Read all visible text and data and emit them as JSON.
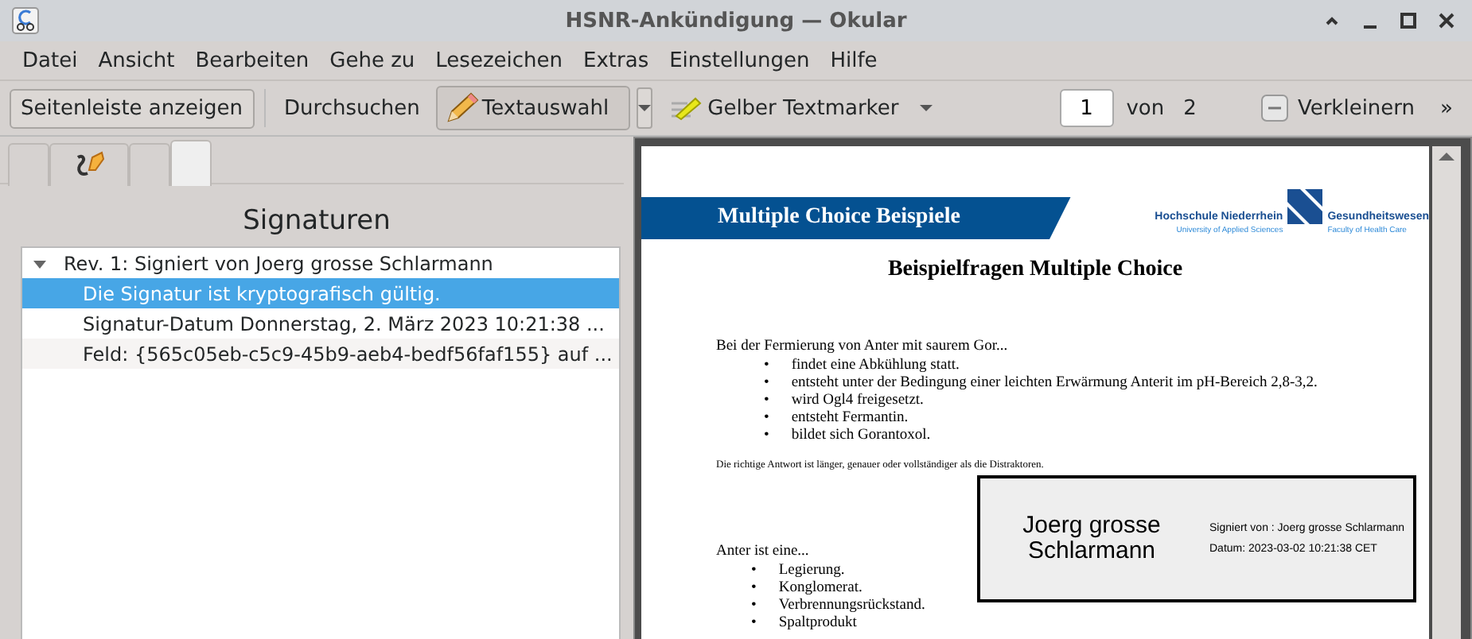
{
  "window": {
    "title": "HSNR-Ankündigung  — Okular"
  },
  "menu": [
    "Datei",
    "Ansicht",
    "Bearbeiten",
    "Gehe zu",
    "Lesezeichen",
    "Extras",
    "Einstellungen",
    "Hilfe"
  ],
  "toolbar": {
    "sidebar_button": "Seitenleiste anzeigen",
    "browse_button": "Durchsuchen",
    "text_select": {
      "label": "Textauswahl",
      "checked": true
    },
    "highlighter": "Gelber Textmarker",
    "page": "1",
    "of_label": "von",
    "page_count": "2",
    "zoom_out": "Verkleinern",
    "overflow": "»"
  },
  "sidebar": {
    "tabs": [
      {
        "kind": "blank",
        "selected": false
      },
      {
        "kind": "signature",
        "selected": false
      },
      {
        "kind": "blank",
        "selected": false
      },
      {
        "kind": "blank",
        "selected": true
      }
    ],
    "heading": "Signaturen",
    "tree": [
      {
        "label": "Rev. 1: Signiert von Joerg grosse Schlarmann",
        "expanded": true,
        "selected": false,
        "children": [
          {
            "label": "Die Signatur ist kryptografisch gültig.",
            "selected": true
          },
          {
            "label": "Signatur-Datum Donnerstag, 2. März 2023 10:21:38 ...",
            "selected": false
          },
          {
            "label": "Feld: {565c05eb-c5c9-45b9-aeb4-bedf56faf155} auf ...",
            "selected": false
          }
        ]
      }
    ]
  },
  "document": {
    "banner": "Multiple Choice Beispiele",
    "logo": {
      "name": "Hochschule Niederrhein",
      "subtitle": "University of Applied Sciences",
      "faculty": "Gesundheitswesen",
      "faculty_subtitle": "Faculty of Health Care"
    },
    "title": "Beispielfragen Multiple Choice",
    "question_1": "Bei der Fermierung von Anter mit saurem Gor...",
    "answers_1": [
      {
        "bullet": "•",
        "text": "findet eine Abkühlung statt."
      },
      {
        "bullet": "•",
        "text": "entsteht unter der Bedingung einer leichten Erwärmung Anterit im pH-Bereich 2,8-3,2."
      },
      {
        "bullet": "•",
        "text": "wird Ogl4 freigesetzt."
      },
      {
        "bullet": "•",
        "text": "entsteht Fermantin."
      },
      {
        "bullet": "•",
        "text": "bildet sich Gorantoxol."
      }
    ],
    "note": "Die richtige Antwort ist länger, genauer oder vollständiger als die Distraktoren.",
    "question_2": "Anter ist eine...",
    "answers_2": [
      {
        "bullet": "•",
        "text": "Legierung."
      },
      {
        "bullet": "•",
        "text": "Konglomerat."
      },
      {
        "bullet": "•",
        "text": "Verbrennungsrückstand."
      },
      {
        "bullet": "•",
        "text": "Spaltprodukt"
      }
    ],
    "signature": {
      "name": "Joerg grosse Schlarmann",
      "signed_by": "Signiert von : Joerg grosse Schlarmann",
      "date": "Datum: 2023-03-02 10:21:38 CET"
    }
  }
}
